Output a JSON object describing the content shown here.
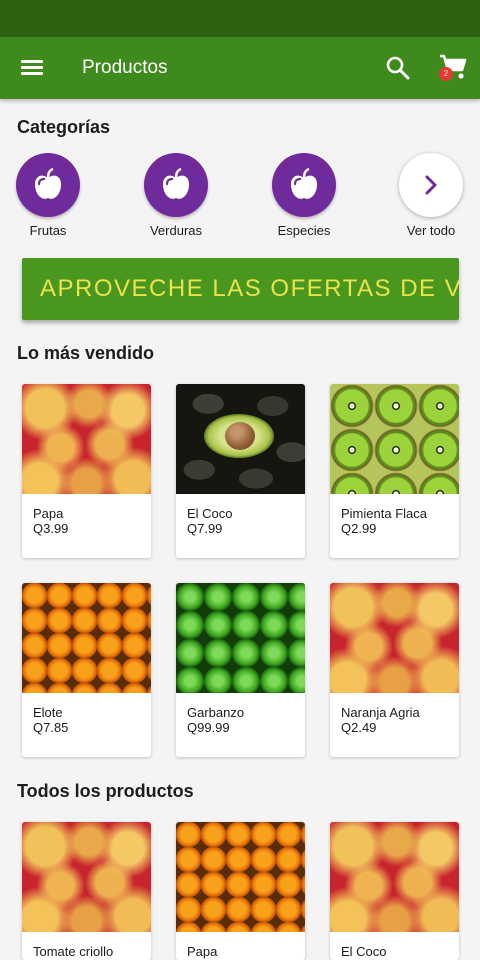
{
  "app_bar": {
    "title": "Productos",
    "icons": [
      "menu-icon",
      "search-icon",
      "cart-icon"
    ],
    "cart_badge": "2",
    "color": "#3f8a1d"
  },
  "categories": {
    "title": "Categorías",
    "items": [
      {
        "label": "Frutas",
        "icon": "apple-icon"
      },
      {
        "label": "Verduras",
        "icon": "apple-icon"
      },
      {
        "label": "Especies",
        "icon": "apple-icon"
      },
      {
        "label": "Ver todo",
        "icon": "chevron-right-icon"
      }
    ],
    "circle_color": "#6f2b9b"
  },
  "promo": {
    "text": "APROVECHE LAS OFERTAS DE VERANO",
    "background": "#4a9720",
    "text_color": "#ece24a"
  },
  "best_sellers": {
    "title": "Lo más vendido",
    "items": [
      {
        "name": "Papa",
        "price": "Q3.99",
        "image": "apples"
      },
      {
        "name": "El Coco",
        "price": "Q7.99",
        "image": "avocado"
      },
      {
        "name": "Pimienta Flaca",
        "price": "Q2.99",
        "image": "kiwis"
      },
      {
        "name": "Elote",
        "price": "Q7.85",
        "image": "oranges"
      },
      {
        "name": "Garbanzo",
        "price": "Q99.99",
        "image": "limes"
      },
      {
        "name": "Naranja Agria",
        "price": "Q2.49",
        "image": "apples"
      }
    ]
  },
  "all_products": {
    "title": "Todos los productos",
    "items": [
      {
        "name": "Tomate criollo",
        "image": "apples"
      },
      {
        "name": "Papa",
        "image": "oranges"
      },
      {
        "name": "El Coco",
        "image": "apples"
      }
    ]
  }
}
